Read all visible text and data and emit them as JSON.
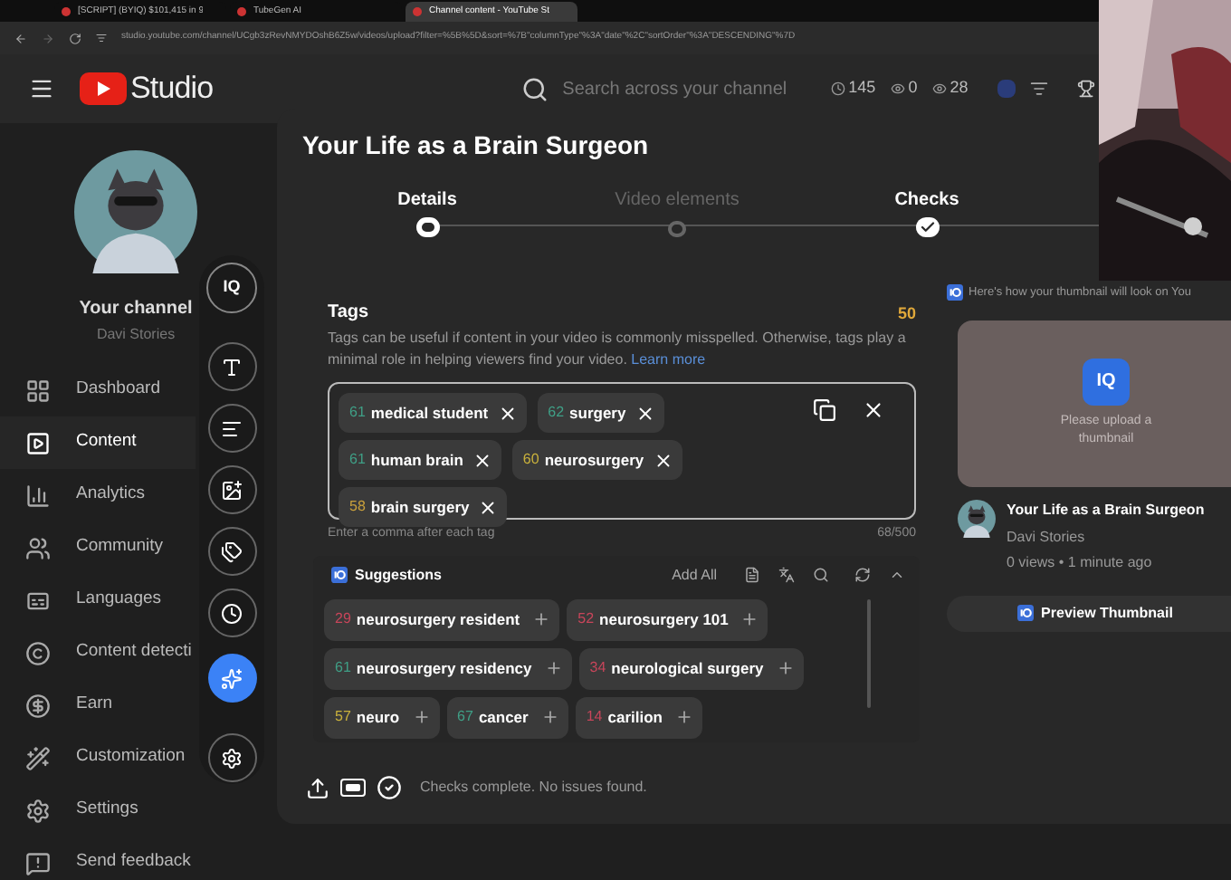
{
  "browser": {
    "tabs": [
      {
        "title": "[SCRIPT] (BYIQ) $101,415 in 9",
        "selected": false
      },
      {
        "title": "TubeGen AI",
        "selected": false
      },
      {
        "title": "Channel content - YouTube St",
        "selected": true
      }
    ],
    "url": "studio.youtube.com/channel/UCgb3zRevNMYDOshB6Z5w/videos/upload?filter=%5B%5D&sort=%7B\"columnType\"%3A\"date\"%2C\"sortOrder\"%3A\"DESCENDING\"%7D"
  },
  "header": {
    "logo": "Studio",
    "search_placeholder": "Search across your channel",
    "stats": [
      {
        "kind": "clock",
        "value": "145"
      },
      {
        "kind": "eye",
        "value": "0"
      },
      {
        "kind": "eye",
        "value": "28"
      }
    ]
  },
  "sidebar": {
    "channel_label": "Your channel",
    "channel_name": "Davi Stories",
    "items": [
      {
        "kind": "dashboard",
        "label": "Dashboard",
        "selected": false
      },
      {
        "kind": "content",
        "label": "Content",
        "selected": true
      },
      {
        "kind": "analytics",
        "label": "Analytics",
        "selected": false
      },
      {
        "kind": "community",
        "label": "Community",
        "selected": false
      },
      {
        "kind": "languages",
        "label": "Languages",
        "selected": false
      },
      {
        "kind": "copyright",
        "label": "Content detecti",
        "selected": false
      },
      {
        "kind": "earn",
        "label": "Earn",
        "selected": false
      },
      {
        "kind": "customization",
        "label": "Customization",
        "selected": false
      }
    ],
    "footer_items": [
      {
        "kind": "settings",
        "label": "Settings"
      },
      {
        "kind": "feedback",
        "label": "Send feedback"
      }
    ]
  },
  "tool_rail": {
    "logo": "IQ",
    "buttons": [
      {
        "kind": "title",
        "selected": false
      },
      {
        "kind": "description",
        "selected": false
      },
      {
        "kind": "thumbnail",
        "selected": false
      },
      {
        "kind": "tags",
        "selected": false
      },
      {
        "kind": "schedule",
        "selected": false
      },
      {
        "kind": "ai",
        "selected": true
      },
      {
        "kind": "settings",
        "selected": false
      }
    ]
  },
  "dialog": {
    "title": "Your Life as a Brain Surgeon",
    "steps": [
      {
        "label": "Details",
        "selected": true,
        "completed": false
      },
      {
        "label": "Video elements",
        "selected": false,
        "completed": false
      },
      {
        "label": "Checks",
        "selected": false,
        "completed": true
      }
    ],
    "tags": {
      "heading": "Tags",
      "score": "50",
      "description": "Tags can be useful if content in your video is commonly misspelled. Otherwise, tags play a minimal role in helping viewers find your video.",
      "link": "Learn more",
      "items": [
        {
          "score": "61",
          "color": "#3f9f86",
          "label": "medical student"
        },
        {
          "score": "62",
          "color": "#3f9f86",
          "label": "surgery"
        },
        {
          "score": "61",
          "color": "#3f9f86",
          "label": "human brain"
        },
        {
          "score": "60",
          "color": "#c9b13c",
          "label": "neurosurgery"
        },
        {
          "score": "58",
          "color": "#c9a03c",
          "label": "brain surgery"
        }
      ],
      "hint": "Enter a comma after each tag",
      "counter": "68/500"
    },
    "suggestions": {
      "title": "Suggestions",
      "add_all": "Add All",
      "items": [
        {
          "score": "29",
          "color": "#c8455a",
          "label": "neurosurgery resident"
        },
        {
          "score": "52",
          "color": "#c8455a",
          "label": "neurosurgery 101"
        },
        {
          "score": "61",
          "color": "#3f9f86",
          "label": "neurosurgery residency"
        },
        {
          "score": "34",
          "color": "#c8455a",
          "label": "neurological surgery"
        },
        {
          "score": "57",
          "color": "#c9b13c",
          "label": "neuro"
        },
        {
          "score": "67",
          "color": "#3f9f86",
          "label": "cancer"
        },
        {
          "score": "14",
          "color": "#c8455a",
          "label": "carilion"
        }
      ]
    },
    "status": "Checks complete. No issues found.",
    "preview": {
      "note": "Here's how your thumbnail will look on You",
      "logo": "IQ",
      "placeholder": "Please upload a thumbnail",
      "video_title": "Your Life as a Brain Surgeon",
      "channel": "Davi Stories",
      "meta": "0 views • 1 minute ago",
      "button": "Preview Thumbnail"
    }
  }
}
